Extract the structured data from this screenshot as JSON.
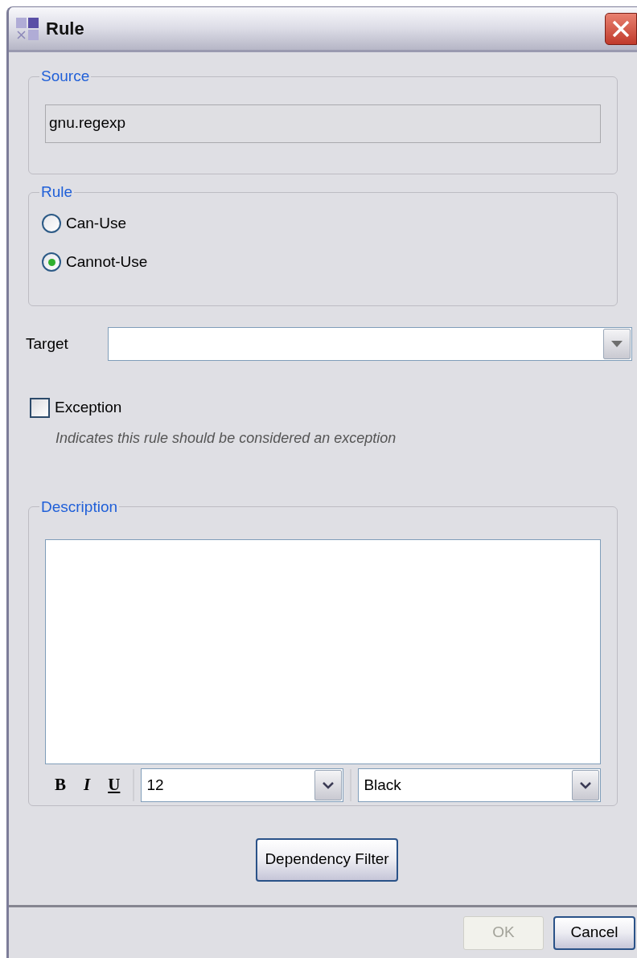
{
  "window": {
    "title": "Rule"
  },
  "source": {
    "legend": "Source",
    "value": "gnu.regexp"
  },
  "rule": {
    "legend": "Rule",
    "options": [
      {
        "label": "Can-Use",
        "selected": false
      },
      {
        "label": "Cannot-Use",
        "selected": true
      }
    ]
  },
  "target": {
    "label": "Target"
  },
  "exception": {
    "label": "Exception",
    "checked": false,
    "hint": "Indicates this rule should be considered an exception"
  },
  "description": {
    "legend": "Description",
    "format_buttons": [
      {
        "kind": "bold",
        "label": "B"
      },
      {
        "kind": "italic",
        "label": "I"
      },
      {
        "kind": "underline",
        "label": "U"
      }
    ],
    "size": "12",
    "text_color": "Black"
  },
  "dependency_button": "Dependency Filter",
  "buttons": [
    {
      "label": "OK",
      "disabled": true
    },
    {
      "label": "Cancel",
      "disabled": false
    }
  ]
}
